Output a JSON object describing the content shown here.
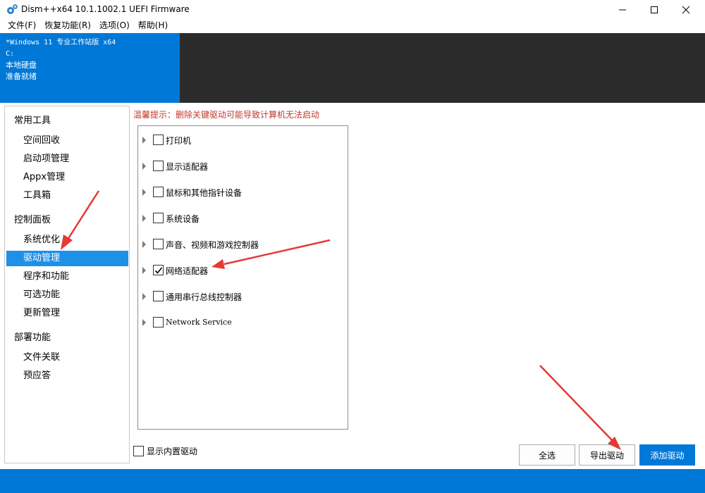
{
  "window": {
    "title": "Dism++x64 10.1.1002.1 UEFI Firmware"
  },
  "menu": [
    "文件(F)",
    "恢复功能(R)",
    "选项(O)",
    "帮助(H)"
  ],
  "header": {
    "os_name": "*Windows 11 专业工作站版 x64",
    "drive": "C:",
    "disk": "本地硬盘",
    "status": "准备就绪"
  },
  "sidebar": {
    "sections": [
      {
        "title": "常用工具",
        "items": [
          "空间回收",
          "启动项管理",
          "Appx管理",
          "工具箱"
        ]
      },
      {
        "title": "控制面板",
        "items": [
          "系统优化",
          "驱动管理",
          "程序和功能",
          "可选功能",
          "更新管理"
        ]
      },
      {
        "title": "部署功能",
        "items": [
          "文件关联",
          "预应答"
        ]
      }
    ],
    "active_item": "驱动管理"
  },
  "main": {
    "warning": "温馨提示：删除关键驱动可能导致计算机无法启动",
    "tree": [
      {
        "label": "打印机",
        "checked": false
      },
      {
        "label": "显示适配器",
        "checked": false
      },
      {
        "label": "鼠标和其他指针设备",
        "checked": false
      },
      {
        "label": "系统设备",
        "checked": false
      },
      {
        "label": "声音、视频和游戏控制器",
        "checked": false
      },
      {
        "label": "网络适配器",
        "checked": true
      },
      {
        "label": "通用串行总线控制器",
        "checked": false
      },
      {
        "label": "Network Service",
        "checked": false
      }
    ],
    "show_builtin_label": "显示内置驱动",
    "buttons": {
      "select_all": "全选",
      "export": "导出驱动",
      "add": "添加驱动"
    }
  },
  "colors": {
    "accent": "#0078d7",
    "dark_panel": "#2b2b2b",
    "warning": "#c0392b",
    "annotation": "#e53935"
  }
}
